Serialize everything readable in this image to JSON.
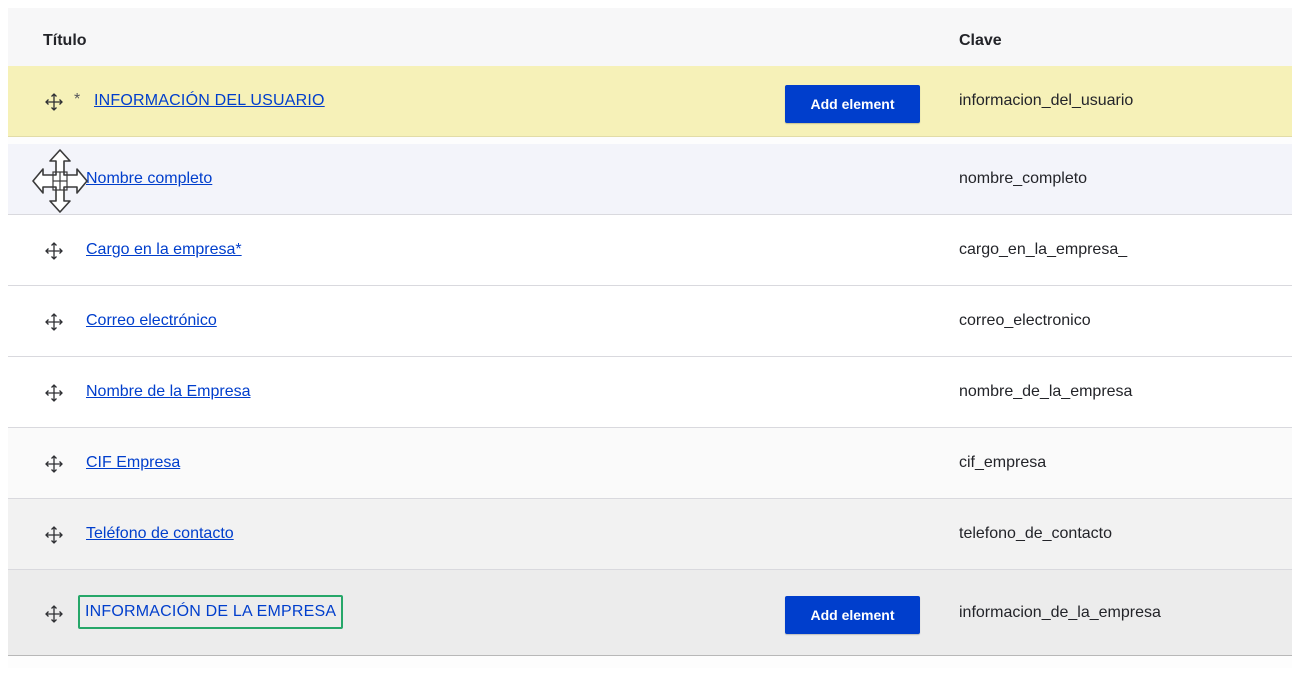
{
  "table": {
    "headers": {
      "title": "Título",
      "key": "Clave"
    },
    "rows": [
      {
        "title": "INFORMACIÓN DEL USUARIO",
        "required_marker": "*",
        "key": "informacion_del_usuario",
        "button": "Add element",
        "type": "group",
        "state": "highlighted"
      },
      {
        "title": "Nombre completo",
        "key": "nombre_completo",
        "type": "item",
        "state": "dragging"
      },
      {
        "title": "Cargo en la empresa*",
        "key": "cargo_en_la_empresa_",
        "type": "item"
      },
      {
        "title": "Correo electrónico",
        "key": "correo_electronico",
        "type": "item"
      },
      {
        "title": "Nombre de la Empresa",
        "key": "nombre_de_la_empresa",
        "type": "item"
      },
      {
        "title": "CIF Empresa",
        "key": "cif_empresa",
        "type": "item"
      },
      {
        "title": "Teléfono de contacto",
        "key": "telefono_de_contacto",
        "type": "item"
      },
      {
        "title": "INFORMACIÓN DE LA EMPRESA",
        "key": "informacion_de_la_empresa",
        "button": "Add element",
        "type": "group",
        "state": "focused"
      }
    ]
  },
  "icons": {
    "drag_handle": "move-arrows-icon",
    "cursor": "move-cursor-icon"
  },
  "colors": {
    "link": "#003ecc",
    "button": "#003ecc",
    "highlight_row": "#f6f1b8",
    "focus_outline": "#26a769"
  }
}
